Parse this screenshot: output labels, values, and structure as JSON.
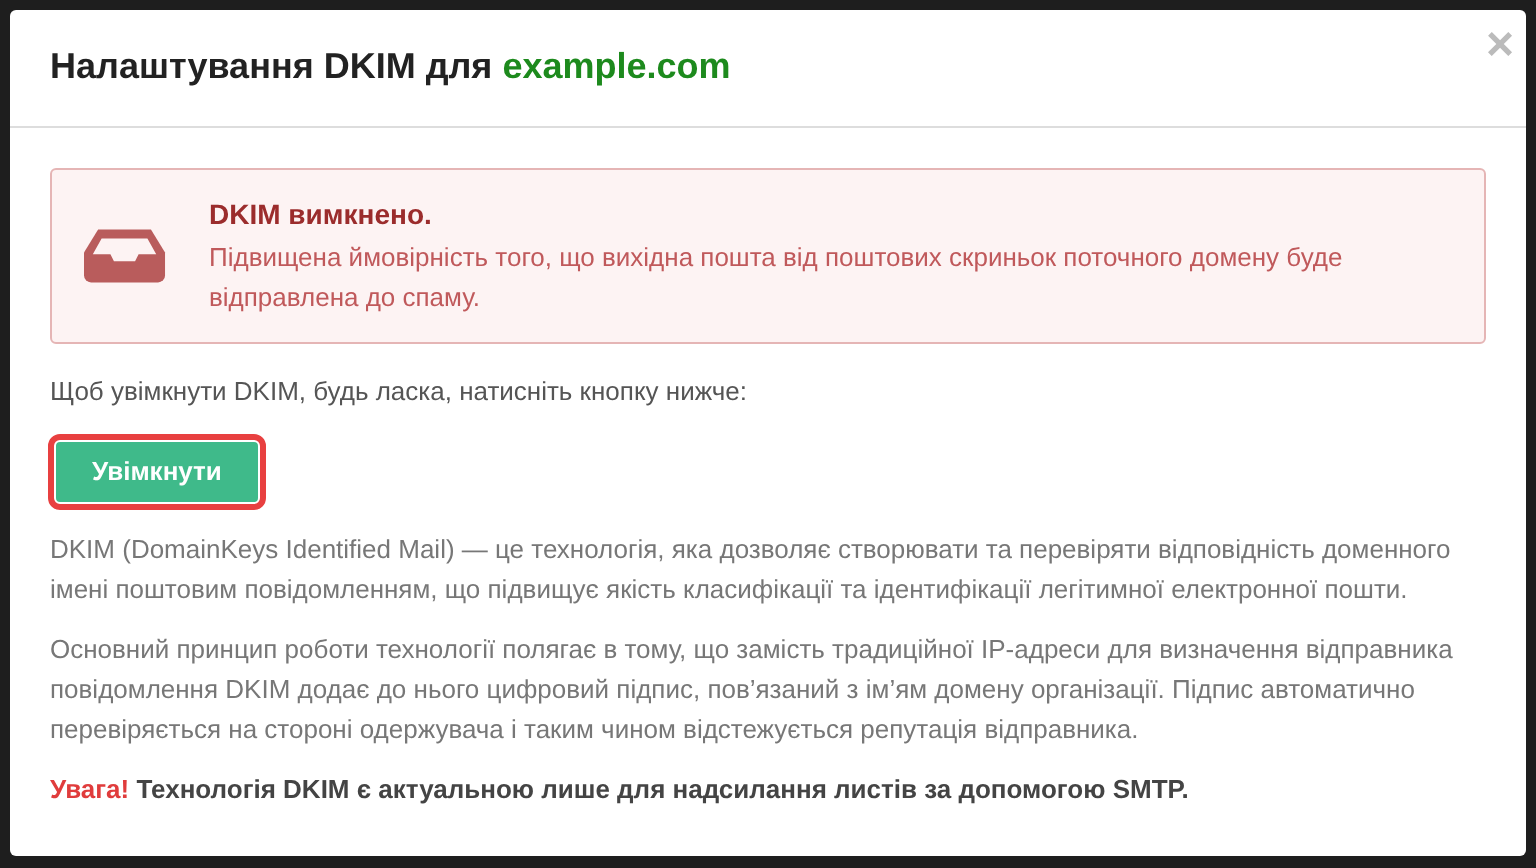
{
  "modal": {
    "title": "Налаштування DKIM для ",
    "domain": "example.com",
    "close": "×"
  },
  "alert": {
    "title": "DKIM вимкнено.",
    "text": "Підвищена ймовірність того, що вихідна пошта від поштових скриньок поточного домену буде відправлена до спаму."
  },
  "instruction": "Щоб увімкнути DKIM, будь ласка, натисніть кнопку нижче:",
  "enable_button": {
    "label": "Увімкнути",
    "highlighted": true
  },
  "paragraphs": [
    "DKIM (DomainKeys Identified Mail) — це технологія, яка дозволяє створювати та перевіряти відповідність доменного імені поштовим повідомленням, що підвищує якість класифікації та ідентифікації легітимної електронної пошти.",
    "Основний принцип роботи технології полягає в тому, що замість традиційної IP-адреси для визначення відправника повідомлення DKIM додає до нього цифровий підпис, пов’язаний з ім’ям домену організації. Підпис автоматично перевіряється на стороні одержувача і таким чином відстежується репутація відправника."
  ],
  "note": {
    "label": "Увага!",
    "text": " Технологія DKIM є актуальною лише для надсилання листів за допомогою SMTP."
  }
}
